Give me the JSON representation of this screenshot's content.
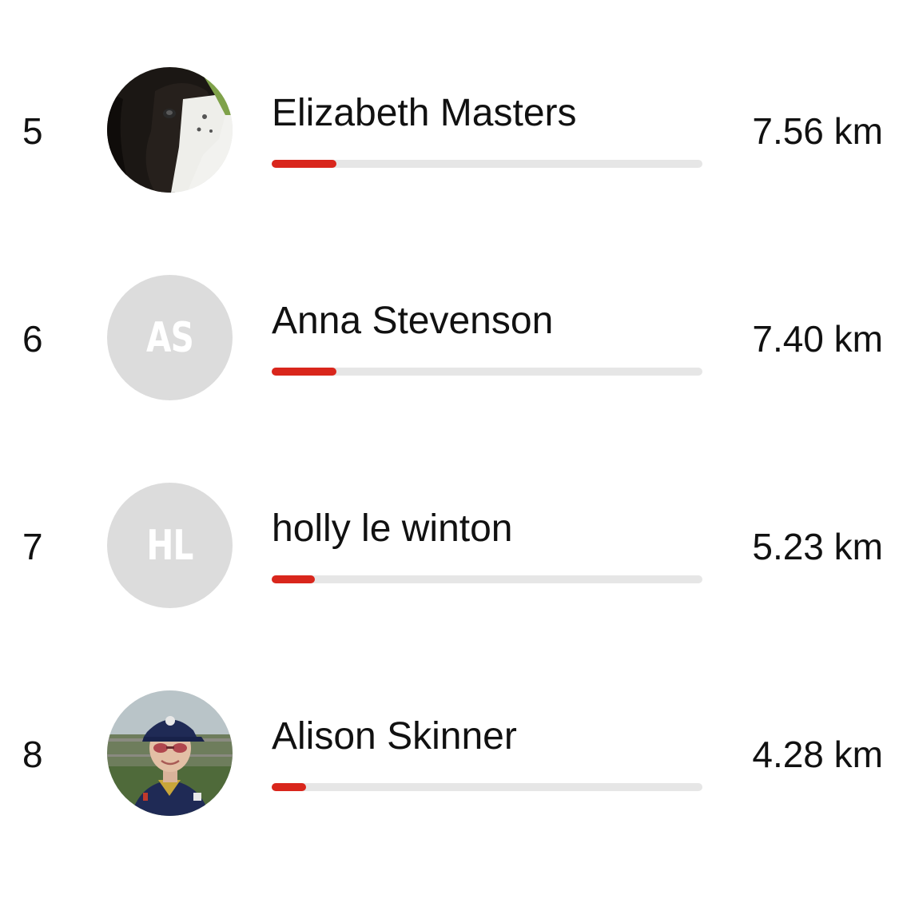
{
  "leaderboard": {
    "accent_color": "#d9261c",
    "track_color": "#e6e6e6",
    "entries": [
      {
        "rank": "5",
        "name": "Elizabeth Masters",
        "distance": "7.56 km",
        "avatar": {
          "type": "photo",
          "icon": "dog-photo"
        },
        "progress": 0.15
      },
      {
        "rank": "6",
        "name": "Anna Stevenson",
        "distance": "7.40 km",
        "avatar": {
          "type": "initials",
          "initials": "AS"
        },
        "progress": 0.15
      },
      {
        "rank": "7",
        "name": "holly le winton",
        "distance": "5.23 km",
        "avatar": {
          "type": "initials",
          "initials": "HL"
        },
        "progress": 0.1
      },
      {
        "rank": "8",
        "name": "Alison Skinner",
        "distance": "4.28 km",
        "avatar": {
          "type": "photo",
          "icon": "person-photo"
        },
        "progress": 0.08
      }
    ]
  }
}
